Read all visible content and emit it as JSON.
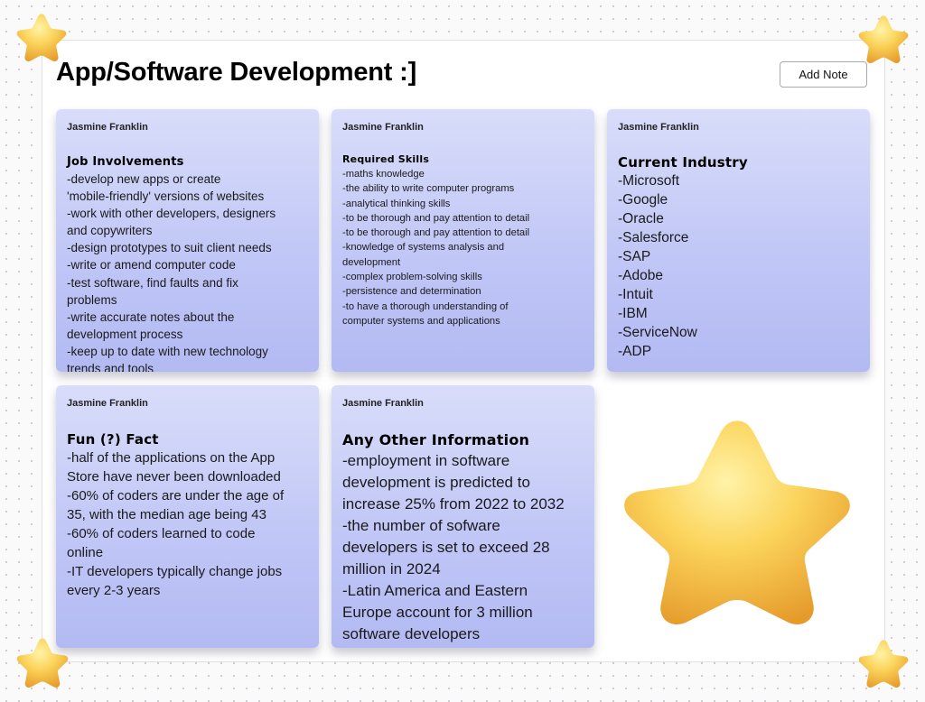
{
  "page": {
    "title": "App/Software Development :]"
  },
  "toolbar": {
    "add_note_label": "Add Note"
  },
  "notes": [
    {
      "author": "Jasmine Franklin",
      "heading": "Job Involvements",
      "lines": [
        "-develop new apps or create",
        "'mobile-friendly' versions of websites",
        "-work with other developers, designers",
        "and copywriters",
        "-design prototypes to suit client needs",
        "-write or amend computer code",
        "-test software, find faults and fix",
        "problems",
        "-write accurate notes about the",
        "development process",
        "-keep up to date with new technology",
        "trends and tools"
      ]
    },
    {
      "author": "Jasmine Franklin",
      "heading": "Required Skills",
      "lines": [
        "-maths knowledge",
        "-the ability to write computer programs",
        "-analytical thinking skills",
        "-to be thorough and pay attention to detail",
        "-to be thorough and pay attention to detail",
        "-knowledge of systems analysis and",
        "development",
        "-complex problem-solving skills",
        "-persistence and determination",
        "-to have a thorough understanding of",
        "computer systems and applications"
      ]
    },
    {
      "author": "Jasmine Franklin",
      "heading": "Current Industry",
      "lines": [
        "-Microsoft",
        "-Google",
        "-Oracle",
        "-Salesforce",
        "-SAP",
        "-Adobe",
        "-Intuit",
        "-IBM",
        "-ServiceNow",
        "-ADP"
      ]
    },
    {
      "author": "Jasmine Franklin",
      "heading": "Fun (?) Fact",
      "lines": [
        "-half of the applications on the App",
        "Store have never been downloaded",
        "-60% of coders are under the age of",
        "35, with the median age being 43",
        "-60% of coders learned to code",
        "online",
        "-IT developers typically change jobs",
        "every 2-3 years"
      ]
    },
    {
      "author": "Jasmine Franklin",
      "heading": "Any Other Information",
      "lines": [
        "-employment in software",
        "development is predicted to",
        "increase 25% from 2022 to 2032",
        "-the number of sofware",
        "developers is set to exceed 28",
        "million in 2024",
        "-Latin America and Eastern",
        "Europe account for 3 million",
        "software developers"
      ]
    }
  ],
  "decorations": {
    "star_icon": "star-icon",
    "star_color": "#f7c948",
    "note_color": "#c5cbf7"
  }
}
